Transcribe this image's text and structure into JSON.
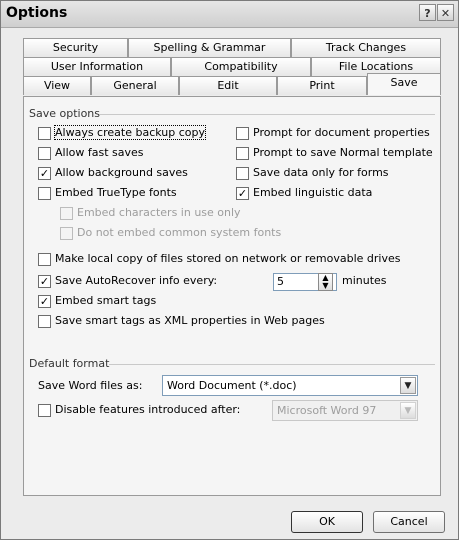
{
  "window": {
    "title": "Options",
    "help_icon": "?",
    "close_icon": "✕"
  },
  "tabs": {
    "row1": [
      "Security",
      "Spelling & Grammar",
      "Track Changes"
    ],
    "row2": [
      "User Information",
      "Compatibility",
      "File Locations"
    ],
    "row3": [
      "View",
      "General",
      "Edit",
      "Print",
      "Save"
    ],
    "active": "Save"
  },
  "save_options": {
    "group_label": "Save options",
    "left": [
      {
        "label": "Always create backup copy",
        "checked": false,
        "disabled": false
      },
      {
        "label": "Allow fast saves",
        "checked": false,
        "disabled": false
      },
      {
        "label": "Allow background saves",
        "checked": true,
        "disabled": false
      },
      {
        "label": "Embed TrueType fonts",
        "checked": false,
        "disabled": false
      },
      {
        "label": "Embed characters in use only",
        "checked": false,
        "disabled": true
      },
      {
        "label": "Do not embed common system fonts",
        "checked": false,
        "disabled": true
      }
    ],
    "right": [
      {
        "label": "Prompt for document properties",
        "checked": false
      },
      {
        "label": "Prompt to save Normal template",
        "checked": false
      },
      {
        "label": "Save data only for forms",
        "checked": false
      },
      {
        "label": "Embed linguistic data",
        "checked": true
      }
    ],
    "bottom": [
      {
        "label": "Make local copy of files stored on network or removable drives",
        "checked": false
      },
      {
        "label": "Save AutoRecover info every:",
        "checked": true
      },
      {
        "label": "Embed smart tags",
        "checked": true
      },
      {
        "label": "Save smart tags as XML properties in Web pages",
        "checked": false
      }
    ],
    "autorecover_value": "5",
    "autorecover_unit": "minutes"
  },
  "default_format": {
    "group_label": "Default format",
    "save_as_label": "Save Word files as:",
    "save_as_value": "Word Document (*.doc)",
    "disable_label": "Disable features introduced after:",
    "disable_checked": false,
    "disable_value": "Microsoft Word 97"
  },
  "buttons": {
    "ok": "OK",
    "cancel": "Cancel"
  },
  "glyphs": {
    "check": "✓",
    "dropdown": "▼",
    "spin_up": "▲",
    "spin_down": "▼"
  }
}
